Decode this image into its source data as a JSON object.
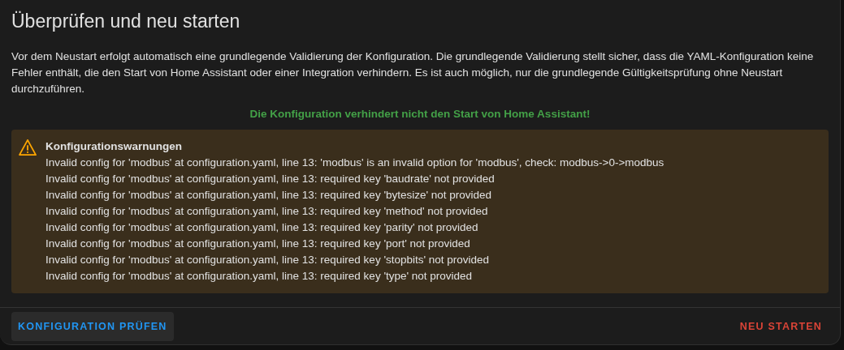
{
  "dialog": {
    "title": "Überprüfen und neu starten",
    "description": "Vor dem Neustart erfolgt automatisch eine grundlegende Validierung der Konfiguration. Die grundlegende Validierung stellt sicher, dass die YAML-Konfiguration keine Fehler enthält, die den Start von Home Assistant oder einer Integration verhindern. Es ist auch möglich, nur die grundlegende Gültigkeitsprüfung ohne Neustart durchzuführen.",
    "status": "Die Konfiguration verhindert nicht den Start von Home Assistant!",
    "warning": {
      "title": "Konfigurationswarnungen",
      "lines": [
        "Invalid config for 'modbus' at configuration.yaml, line 13: 'modbus' is an invalid option for 'modbus', check: modbus->0->modbus",
        "Invalid config for 'modbus' at configuration.yaml, line 13: required key 'baudrate' not provided",
        "Invalid config for 'modbus' at configuration.yaml, line 13: required key 'bytesize' not provided",
        "Invalid config for 'modbus' at configuration.yaml, line 13: required key 'method' not provided",
        "Invalid config for 'modbus' at configuration.yaml, line 13: required key 'parity' not provided",
        "Invalid config for 'modbus' at configuration.yaml, line 13: required key 'port' not provided",
        "Invalid config for 'modbus' at configuration.yaml, line 13: required key 'stopbits' not provided",
        "Invalid config for 'modbus' at configuration.yaml, line 13: required key 'type' not provided"
      ]
    },
    "buttons": [
      {
        "label": "KONFIGURATION PRÜFEN",
        "kind": "secondary"
      },
      {
        "label": "NEU STARTEN",
        "kind": "danger"
      }
    ]
  }
}
